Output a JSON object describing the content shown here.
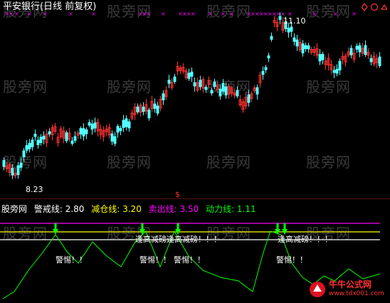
{
  "title": "平安银行(日线 前复权)",
  "watermark": "股旁网",
  "price_high_label": "11.10",
  "price_low_label": "8.23",
  "dollar_marker": "$",
  "indicator": {
    "source": "股旁网",
    "items": [
      {
        "label": "警戒线: 2.80",
        "color": "#ffffff"
      },
      {
        "label": "减仓线: 3.20",
        "color": "#ffff00"
      },
      {
        "label": "卖出线: 3.50",
        "color": "#ff00ff"
      },
      {
        "label": "动力线: 1.11",
        "color": "#00ff00"
      }
    ]
  },
  "alerts": {
    "warning": "警惕！！",
    "high_reduce": "逢高减磅！！！",
    "overlap_left": "逢高减磅逢高减磅！！！",
    "overlap_right": "逢高减磅！！！"
  },
  "logo": {
    "name": "牛牛公式网",
    "url": "www.tdx001.com"
  },
  "icons": [
    "diamond-icon",
    "circle-icon",
    "caret-up-icon"
  ],
  "colors": {
    "up_candle": "#ff3232",
    "down_candle": "#54ffff",
    "line_sell": "#ff00ff",
    "line_reduce": "#ffff00",
    "line_warn": "#ffffff",
    "power_line": "#00ff00",
    "marker_x": "#ff00ff"
  }
}
